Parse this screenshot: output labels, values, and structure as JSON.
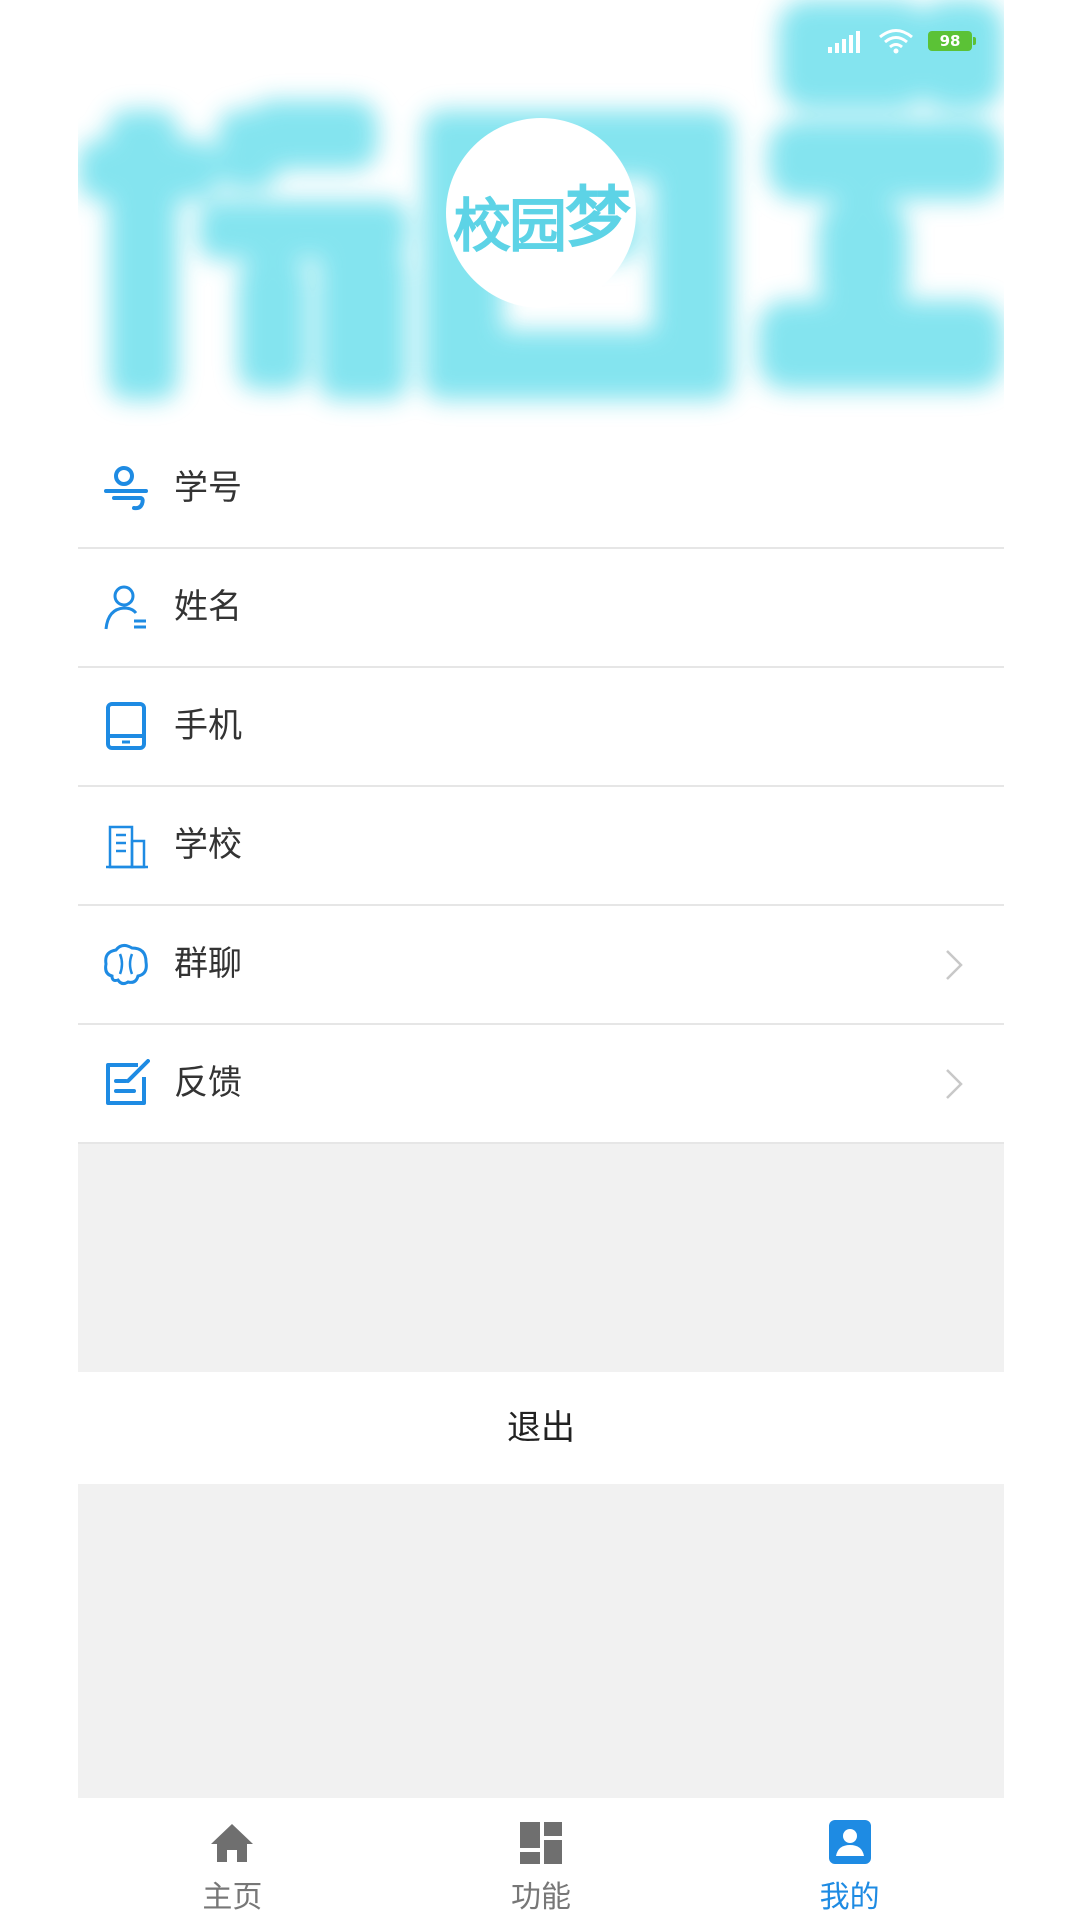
{
  "status_bar": {
    "battery": "98",
    "signal_icon": "signal-icon",
    "wifi_icon": "wifi-icon"
  },
  "header": {
    "logo_text": "校园",
    "logo_char": "梦",
    "banner_color": "#5dd3e6"
  },
  "profile": {
    "items": [
      {
        "label": "学号",
        "icon": "id-number-icon",
        "has_chevron": false
      },
      {
        "label": "姓名",
        "icon": "person-icon",
        "has_chevron": false
      },
      {
        "label": "手机",
        "icon": "phone-icon",
        "has_chevron": false
      },
      {
        "label": "学校",
        "icon": "building-icon",
        "has_chevron": false
      },
      {
        "label": "群聊",
        "icon": "group-chat-icon",
        "has_chevron": true
      },
      {
        "label": "反馈",
        "icon": "feedback-icon",
        "has_chevron": true
      }
    ]
  },
  "logout": {
    "label": "退出"
  },
  "tabbar": {
    "tabs": [
      {
        "label": "主页",
        "icon": "home-icon",
        "active": false
      },
      {
        "label": "功能",
        "icon": "dashboard-icon",
        "active": false
      },
      {
        "label": "我的",
        "icon": "profile-icon",
        "active": true
      }
    ]
  },
  "colors": {
    "accent": "#1e8be3",
    "logo": "#5dd3e6",
    "divider": "#e6e6e6",
    "gray_background": "#f1f1f1"
  }
}
